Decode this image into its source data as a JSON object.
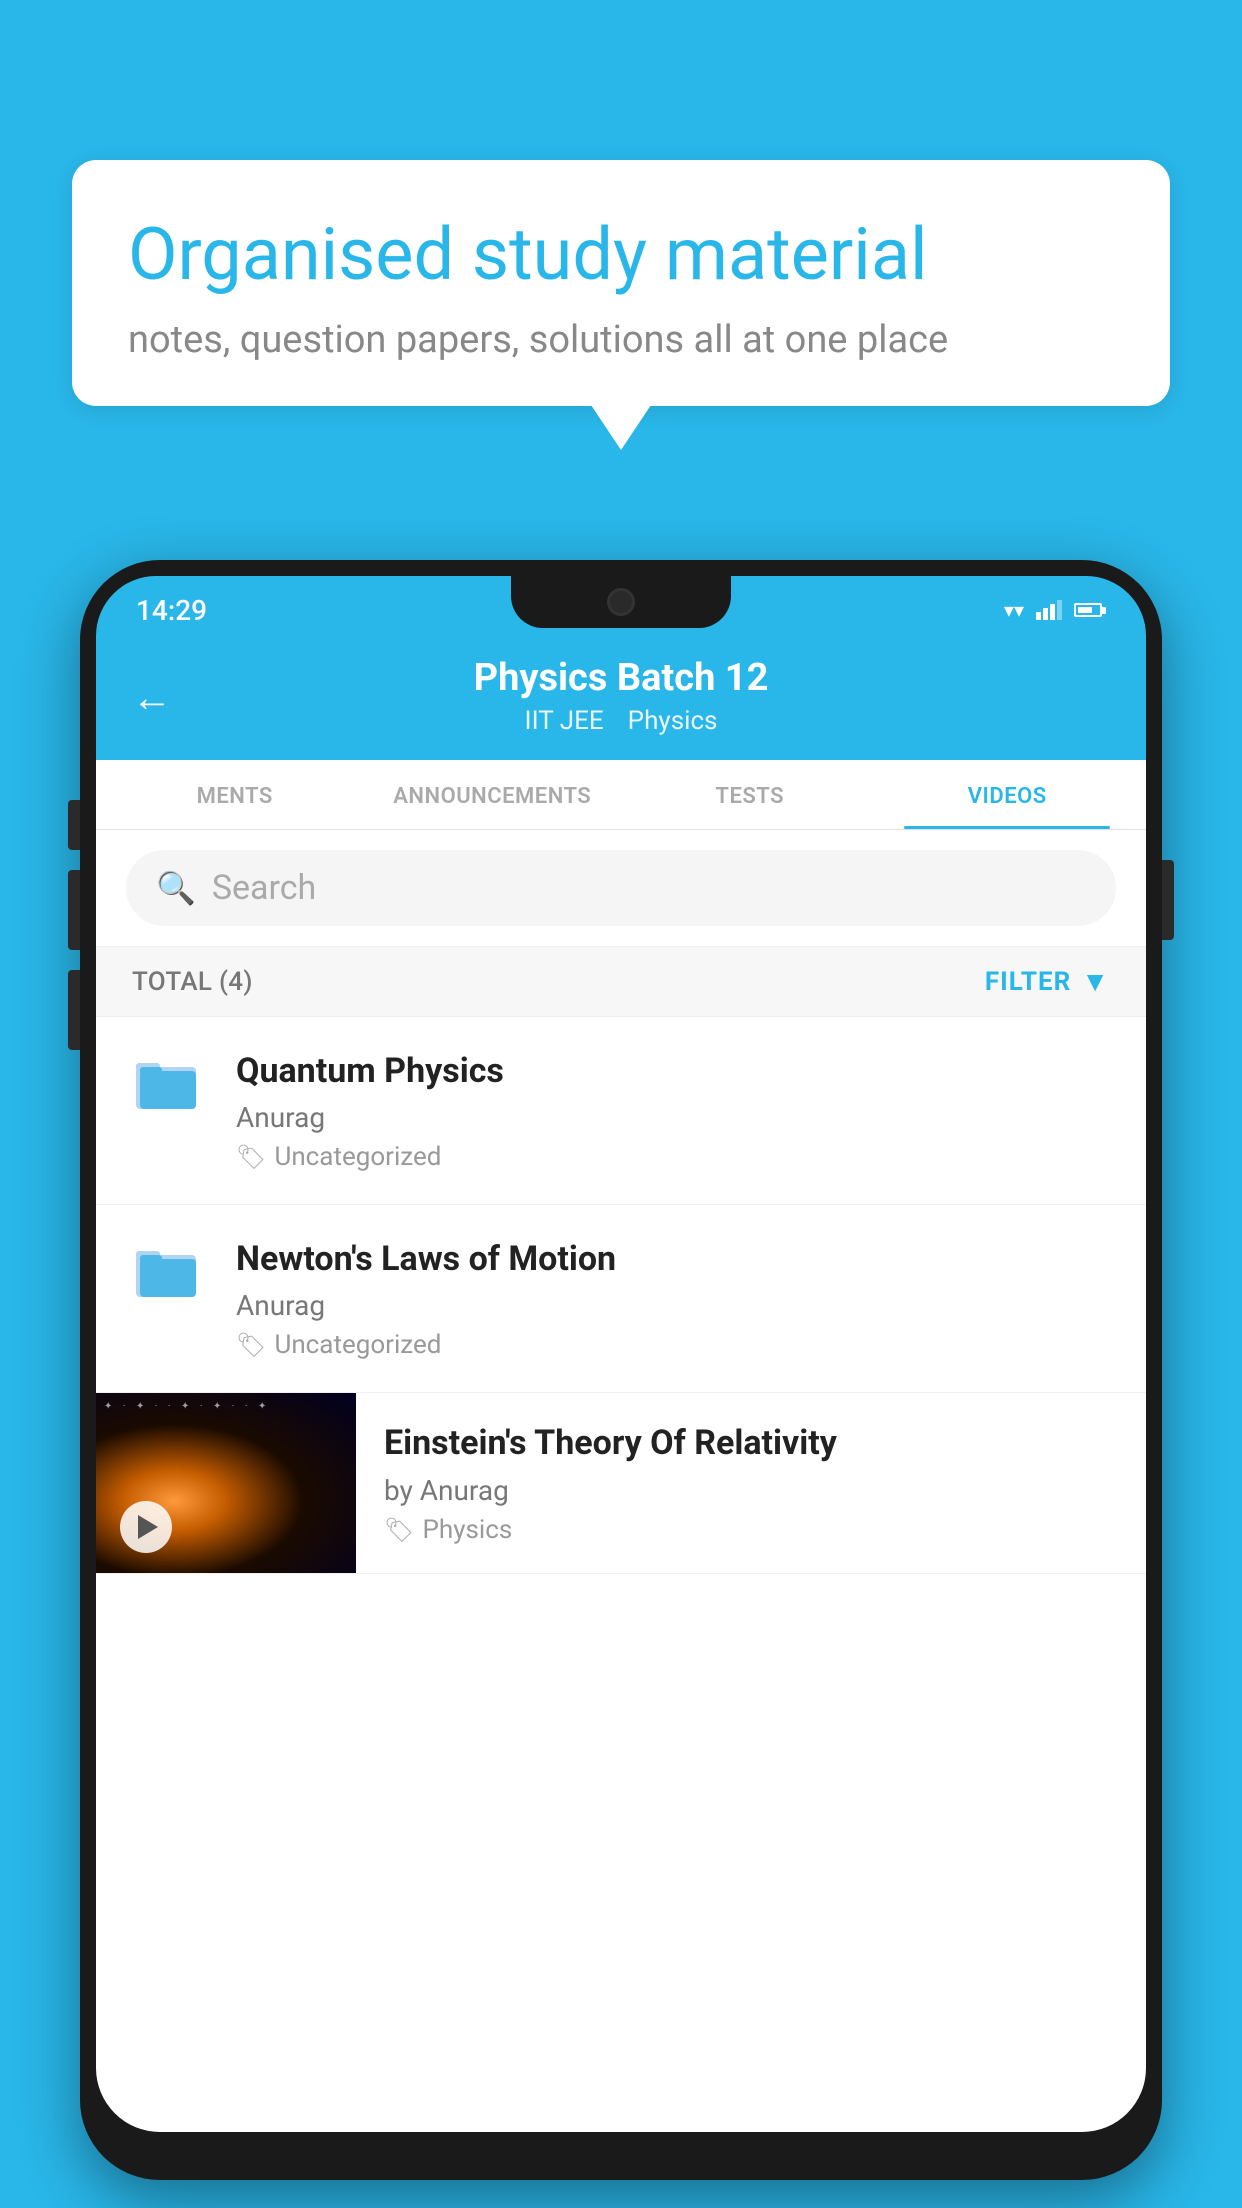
{
  "background_color": "#29b6e8",
  "bubble": {
    "title": "Organised study material",
    "subtitle": "notes, question papers, solutions all at one place"
  },
  "phone": {
    "status_bar": {
      "time": "14:29"
    },
    "header": {
      "title": "Physics Batch 12",
      "breadcrumb_1": "IIT JEE",
      "breadcrumb_2": "Physics"
    },
    "tabs": [
      {
        "label": "MENTS",
        "active": false
      },
      {
        "label": "ANNOUNCEMENTS",
        "active": false
      },
      {
        "label": "TESTS",
        "active": false
      },
      {
        "label": "VIDEOS",
        "active": true
      }
    ],
    "search": {
      "placeholder": "Search"
    },
    "filter_row": {
      "total_label": "TOTAL (4)",
      "filter_label": "FILTER"
    },
    "videos": [
      {
        "title": "Quantum Physics",
        "author": "Anurag",
        "tag": "Uncategorized",
        "type": "folder"
      },
      {
        "title": "Newton's Laws of Motion",
        "author": "Anurag",
        "tag": "Uncategorized",
        "type": "folder"
      },
      {
        "title": "Einstein's Theory Of Relativity",
        "author": "by Anurag",
        "tag": "Physics",
        "type": "thumbnail"
      }
    ]
  }
}
